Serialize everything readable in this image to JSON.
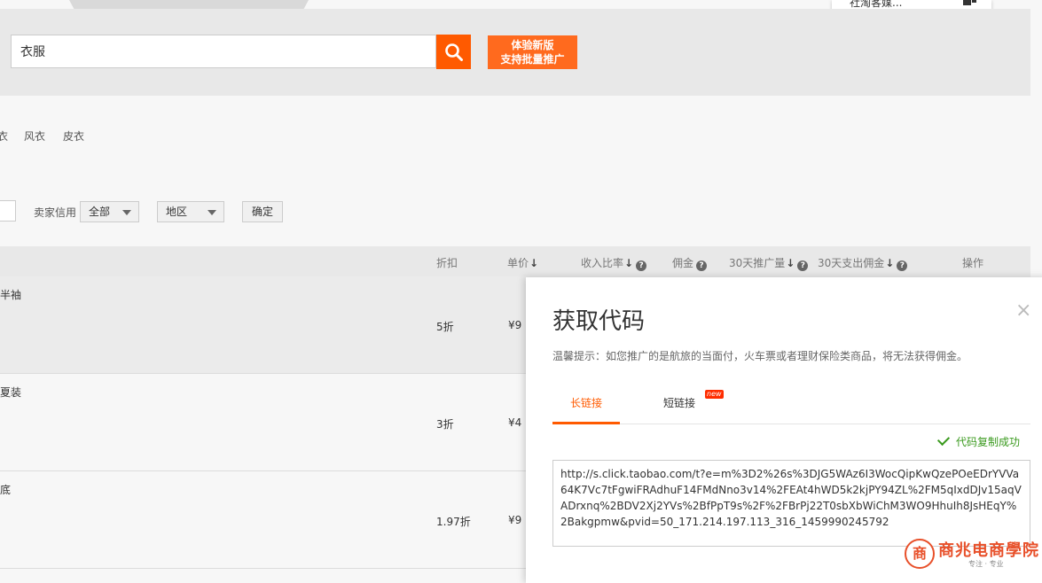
{
  "search": {
    "value": "衣服",
    "new_version_line1": "体验新版",
    "new_version_line2": "支持批量推广"
  },
  "float_menu": {
    "text": "社淘客媒..."
  },
  "categories": [
    "衣",
    "风衣",
    "皮衣"
  ],
  "filters": {
    "seller_credit_label": "卖家信用",
    "credit_value": "全部",
    "region_value": "地区",
    "confirm_label": "确定"
  },
  "table": {
    "headers": {
      "discount": "折扣",
      "unit_price": "单价",
      "income_ratio": "收入比率",
      "commission": "佣金",
      "promo_30d": "30天推广量",
      "spend_30d": "30天支出佣金",
      "action": "操作"
    },
    "rows": [
      {
        "title": "半袖",
        "discount": "5折",
        "price": "¥9"
      },
      {
        "title": "夏装",
        "discount": "3折",
        "price": "¥4"
      },
      {
        "title": "底",
        "discount": "1.97折",
        "price": "¥9"
      }
    ]
  },
  "modal": {
    "title": "获取代码",
    "close": "×",
    "tip": "温馨提示：如您推广的是航旅的当面付，火车票或者理财保险类商品，将无法获得佣金。",
    "tab_long": "长链接",
    "tab_short": "短链接",
    "new_badge": "new",
    "copy_success": "代码复制成功",
    "code": "http://s.click.taobao.com/t?e=m%3D2%26s%3DJG5WAz6I3WocQipKwQzePOeEDrYVVa64K7Vc7tFgwiFRAdhuF14FMdNno3v14%2FEAt4hWD5k2kjPY94ZL%2FM5qIxdDJv15aqVADrxnq%2BDV2Xj2YVs%2BfPpT9s%2F%2FBrPj22T0sbXbWiChM3WO9HhuIh8JsHEqY%2Bakgpmw&pvid=50_171.214.197.113_316_1459990245792"
  },
  "watermark": {
    "logo_char": "商",
    "text": "商兆电商學院",
    "sub": "专注 · 专业"
  },
  "colors": {
    "accent": "#ff5a00",
    "success": "#3a9a1e"
  }
}
